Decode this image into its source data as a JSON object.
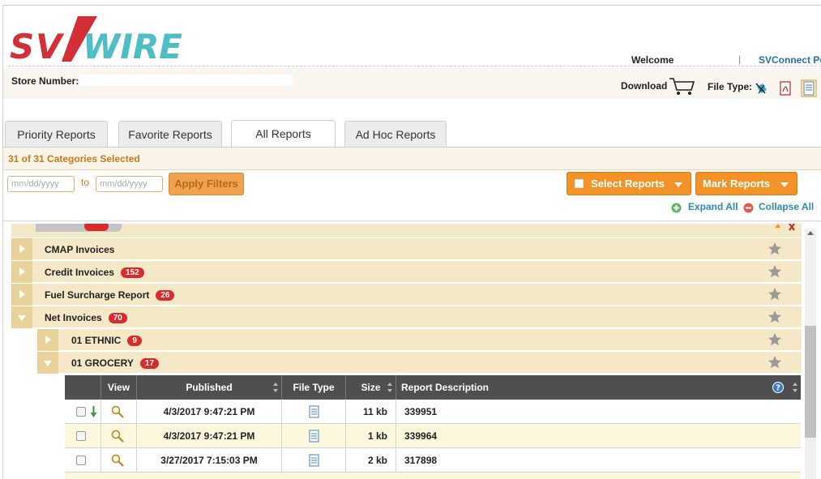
{
  "header": {
    "brand": "SVWIRE",
    "welcome_label": "Welcome",
    "separator": "|",
    "connect_link": "SVConnect Po",
    "store_number_label": "Store Number:",
    "download_label": "Download",
    "file_type_label": "File Type:"
  },
  "tabs": [
    {
      "label": "Priority Reports"
    },
    {
      "label": "Favorite Reports"
    },
    {
      "label": "All Reports"
    },
    {
      "label": "Ad Hoc Reports"
    }
  ],
  "categories_selected": "31 of 31 Categories Selected",
  "filters": {
    "from_placeholder": "mm/dd/yyyy",
    "to_label": "to",
    "to_placeholder": "mm/dd/yyyy",
    "apply_label": "Apply Filters"
  },
  "actions": {
    "select_reports": "Select Reports",
    "mark_reports": "Mark Reports",
    "expand_all": "Expand All",
    "collapse_all": "Collapse All"
  },
  "tree": [
    {
      "label": "CMAP Invoices",
      "count": "",
      "expanded": false,
      "level": 0
    },
    {
      "label": "Credit Invoices",
      "count": "152",
      "expanded": false,
      "level": 0
    },
    {
      "label": "Fuel Surcharge Report",
      "count": "26",
      "expanded": false,
      "level": 0
    },
    {
      "label": "Net Invoices",
      "count": "70",
      "expanded": true,
      "level": 0
    },
    {
      "label": "01 ETHNIC",
      "count": "9",
      "expanded": false,
      "level": 1
    },
    {
      "label": "01 GROCERY",
      "count": "17",
      "expanded": true,
      "level": 1
    }
  ],
  "table": {
    "columns": [
      "View",
      "Published",
      "File Type",
      "Size",
      "Report Description"
    ],
    "rows": [
      {
        "published": "4/3/2017 9:47:21 PM",
        "size": "11 kb",
        "description": "339951",
        "downloaded": true
      },
      {
        "published": "4/3/2017 9:47:21 PM",
        "size": "1 kb",
        "description": "339964",
        "downloaded": false
      },
      {
        "published": "3/27/2017 7:15:03 PM",
        "size": "2 kb",
        "description": "317898",
        "downloaded": false
      }
    ]
  },
  "colors": {
    "orange": "#f29227",
    "brand_red": "#d32f36",
    "brand_teal": "#4dbdc6",
    "tree_bg": "#f4e8c6",
    "badge_red": "#d92b2b",
    "link_blue": "#2a8bb0"
  }
}
